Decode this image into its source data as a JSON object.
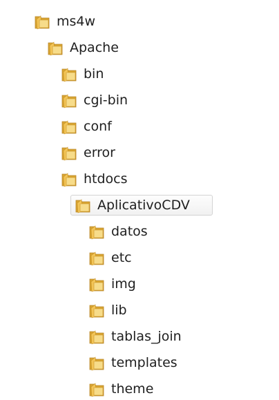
{
  "tree": {
    "items": [
      {
        "label": "ms4w",
        "icon": "folder-icon",
        "level": 0
      },
      {
        "label": "Apache",
        "icon": "folder-icon",
        "level": 1
      },
      {
        "label": "bin",
        "icon": "folder-icon",
        "level": 2
      },
      {
        "label": "cgi-bin",
        "icon": "folder-icon",
        "level": 2
      },
      {
        "label": "conf",
        "icon": "folder-icon",
        "level": 2
      },
      {
        "label": "error",
        "icon": "folder-icon",
        "level": 2
      },
      {
        "label": "htdocs",
        "icon": "folder-icon",
        "level": 2
      },
      {
        "label": "AplicativoCDV",
        "icon": "folder-icon",
        "level": 3,
        "selected": true
      },
      {
        "label": "datos",
        "icon": "folder-icon",
        "level": 4
      },
      {
        "label": "etc",
        "icon": "folder-icon",
        "level": 4
      },
      {
        "label": "img",
        "icon": "folder-icon",
        "level": 4
      },
      {
        "label": "lib",
        "icon": "folder-icon",
        "level": 4
      },
      {
        "label": "tablas_join",
        "icon": "folder-icon",
        "level": 4
      },
      {
        "label": "templates",
        "icon": "folder-icon",
        "level": 4
      },
      {
        "label": "theme",
        "icon": "folder-icon",
        "level": 4
      }
    ]
  },
  "colors": {
    "folder_light": "#f7dc8a",
    "folder_dark": "#d9a531",
    "folder_edge": "#b9862a",
    "selection_border": "#d3d3d3"
  }
}
